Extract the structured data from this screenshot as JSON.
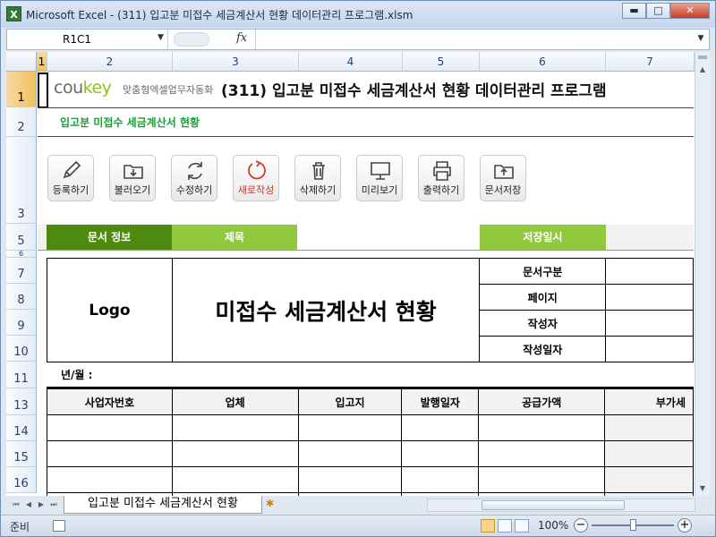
{
  "window": {
    "title": "Microsoft Excel - (311) 입고분 미접수 세금계산서 현황 데이터관리 프로그램.xlsm",
    "app_icon": "X",
    "buttons": {
      "minimize": "▬",
      "maximize": "□",
      "close": "✕"
    }
  },
  "formula_bar": {
    "name_box": "R1C1",
    "fx_label": "fx",
    "formula": ""
  },
  "columns": [
    "1",
    "2",
    "3",
    "4",
    "5",
    "6",
    "7"
  ],
  "rows": [
    "1",
    "2",
    "3",
    "5",
    "6",
    "7",
    "8",
    "9",
    "10",
    "11",
    "13",
    "14",
    "15",
    "16"
  ],
  "sheet": {
    "logo_main": "cou",
    "logo_accent": "key",
    "logo_sub": "맞춤형엑셀업무자동화",
    "program_title": "(311) 입고분 미접수 세금계산서 현황 데이터관리 프로그램",
    "subtitle": "입고분 미접수 세금계산서 현황",
    "tools": [
      {
        "label": "등록하기",
        "icon": "pencil-icon"
      },
      {
        "label": "불러오기",
        "icon": "folder-download-icon"
      },
      {
        "label": "수정하기",
        "icon": "refresh-icon"
      },
      {
        "label": "새로작성",
        "icon": "new-circle-icon"
      },
      {
        "label": "삭제하기",
        "icon": "trash-icon"
      },
      {
        "label": "미리보기",
        "icon": "monitor-icon"
      },
      {
        "label": "출력하기",
        "icon": "printer-icon"
      },
      {
        "label": "문서저장",
        "icon": "folder-upload-icon"
      }
    ],
    "info_headers": {
      "doc_info": "문서 정보",
      "title": "제목",
      "saved_at": "저장일시"
    },
    "document": {
      "logo": "Logo",
      "title": "미접수 세금계산서 현황",
      "meta": [
        "문서구분",
        "페이지",
        "작성자",
        "작성일자"
      ]
    },
    "year_month_label": "년/월 :",
    "table_headers": [
      "사업자번호",
      "업체",
      "입고지",
      "발행일자",
      "공급가액",
      "부가세"
    ]
  },
  "sheet_tab": "입고분 미접수 세금계산서 현황",
  "status": {
    "ready": "준비",
    "zoom": "100%"
  },
  "colors": {
    "accent_dark_green": "#4f8a10",
    "accent_light_green": "#92c83e",
    "subtitle_green": "#19a335"
  }
}
